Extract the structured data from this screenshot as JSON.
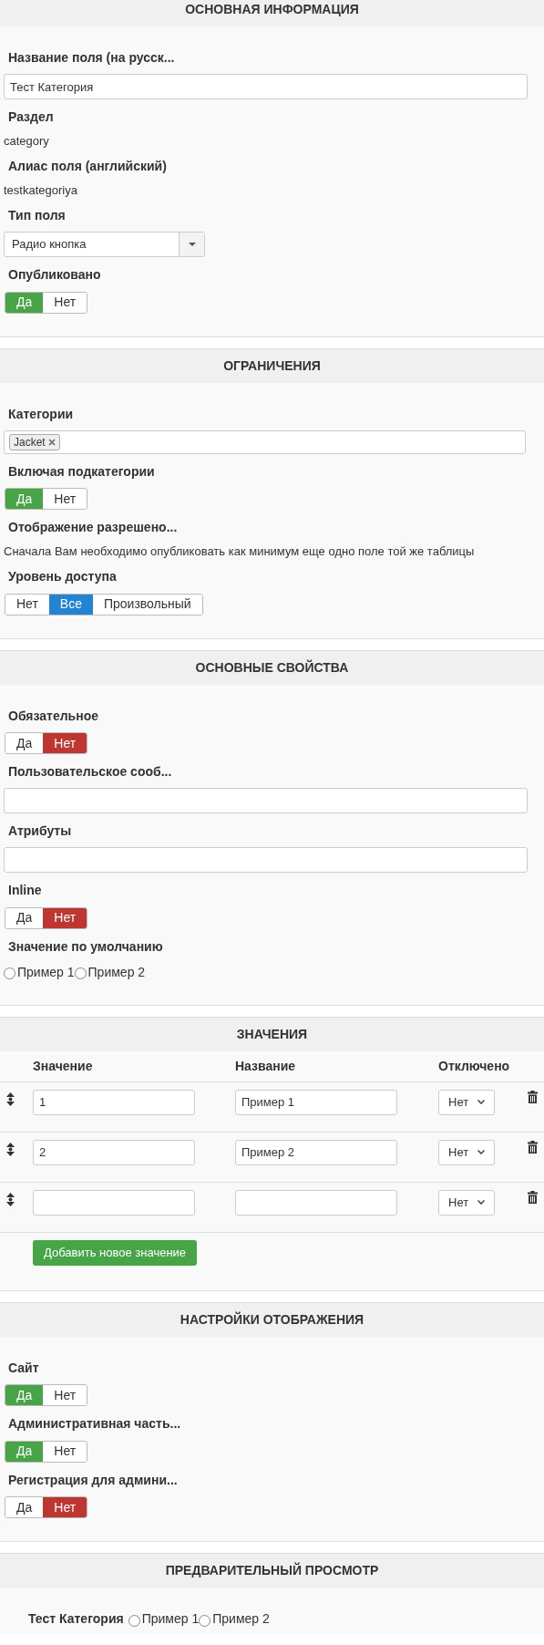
{
  "sections": [
    {
      "kind": "form",
      "title": "ОСНОВНАЯ ИНФОРМАЦИЯ",
      "items": [
        {
          "kind": "input",
          "label": "Название поля (на русск...",
          "value": "Тест Категория"
        },
        {
          "kind": "static",
          "label": "Раздел",
          "value": "category"
        },
        {
          "kind": "static",
          "label": "Алиас поля (английский)",
          "value": "testkategoriya"
        },
        {
          "kind": "select",
          "label": "Тип поля",
          "value": "Радио кнопка"
        },
        {
          "kind": "toggle",
          "label": "Опубликовано",
          "options": [
            {
              "label": "Да",
              "selected": true,
              "color": "#47a447"
            },
            {
              "label": "Нет",
              "selected": false
            }
          ]
        }
      ]
    },
    {
      "kind": "form",
      "title": "ОГРАНИЧЕНИЯ",
      "items": [
        {
          "kind": "tags",
          "label": "Категории",
          "tags": [
            "Jacket"
          ]
        },
        {
          "kind": "toggle",
          "label": "Включая подкатегории",
          "options": [
            {
              "label": "Да",
              "selected": true,
              "color": "#47a447"
            },
            {
              "label": "Нет",
              "selected": false
            }
          ]
        },
        {
          "kind": "static",
          "label": "Отображение разрешено...",
          "value": "Сначала Вам необходимо опубликовать как минимум еще одно поле той же таблицы"
        },
        {
          "kind": "toggle",
          "label": "Уровень доступа",
          "options": [
            {
              "label": "Нет",
              "selected": false
            },
            {
              "label": "Все",
              "selected": true,
              "color": "#2384d3"
            },
            {
              "label": "Произвольный",
              "selected": false
            }
          ]
        }
      ]
    },
    {
      "kind": "form",
      "title": "ОСНОВНЫЕ СВОЙСТВА",
      "items": [
        {
          "kind": "toggle",
          "label": "Обязательное",
          "options": [
            {
              "label": "Да",
              "selected": false
            },
            {
              "label": "Нет",
              "selected": true,
              "color": "#bd362f"
            }
          ]
        },
        {
          "kind": "input",
          "label": "Пользовательское сооб..."
        },
        {
          "kind": "input",
          "label": "Атрибуты"
        },
        {
          "kind": "toggle",
          "label": "Inline",
          "options": [
            {
              "label": "Да",
              "selected": false
            },
            {
              "label": "Нет",
              "selected": true,
              "color": "#bd362f"
            }
          ]
        },
        {
          "kind": "radios",
          "label": "Значение по умолчанию",
          "options": [
            {
              "label": "Пример 1",
              "selected": false
            },
            {
              "label": "Пример 2",
              "selected": false
            }
          ]
        }
      ]
    },
    {
      "kind": "values",
      "title": "ЗНАЧЕНИЯ",
      "columns": [
        "Значение",
        "Название",
        "Отключено"
      ],
      "rows": [
        {
          "value": "1",
          "name": "Пример 1",
          "disabled": "Нет"
        },
        {
          "value": "2",
          "name": "Пример 2",
          "disabled": "Нет"
        },
        {
          "disabled": "Нет"
        }
      ],
      "add_button": "Добавить новое значение"
    },
    {
      "kind": "form",
      "title": "НАСТРОЙКИ ОТОБРАЖЕНИЯ",
      "items": [
        {
          "kind": "toggle",
          "label": "Сайт",
          "options": [
            {
              "label": "Да",
              "selected": true,
              "color": "#47a447"
            },
            {
              "label": "Нет",
              "selected": false
            }
          ]
        },
        {
          "kind": "toggle",
          "label": "Административная часть...",
          "options": [
            {
              "label": "Да",
              "selected": true,
              "color": "#47a447"
            },
            {
              "label": "Нет",
              "selected": false
            }
          ]
        },
        {
          "kind": "toggle",
          "label": "Регистрация для админи...",
          "options": [
            {
              "label": "Да",
              "selected": false
            },
            {
              "label": "Нет",
              "selected": true,
              "color": "#bd362f"
            }
          ]
        }
      ]
    },
    {
      "kind": "preview",
      "title": "ПРЕДВАРИТЕЛЬНЫЙ ПРОСМОТР",
      "label": "Тест Категория",
      "options": [
        {
          "label": "Пример 1",
          "selected": false
        },
        {
          "label": "Пример 2",
          "selected": false
        }
      ]
    }
  ]
}
